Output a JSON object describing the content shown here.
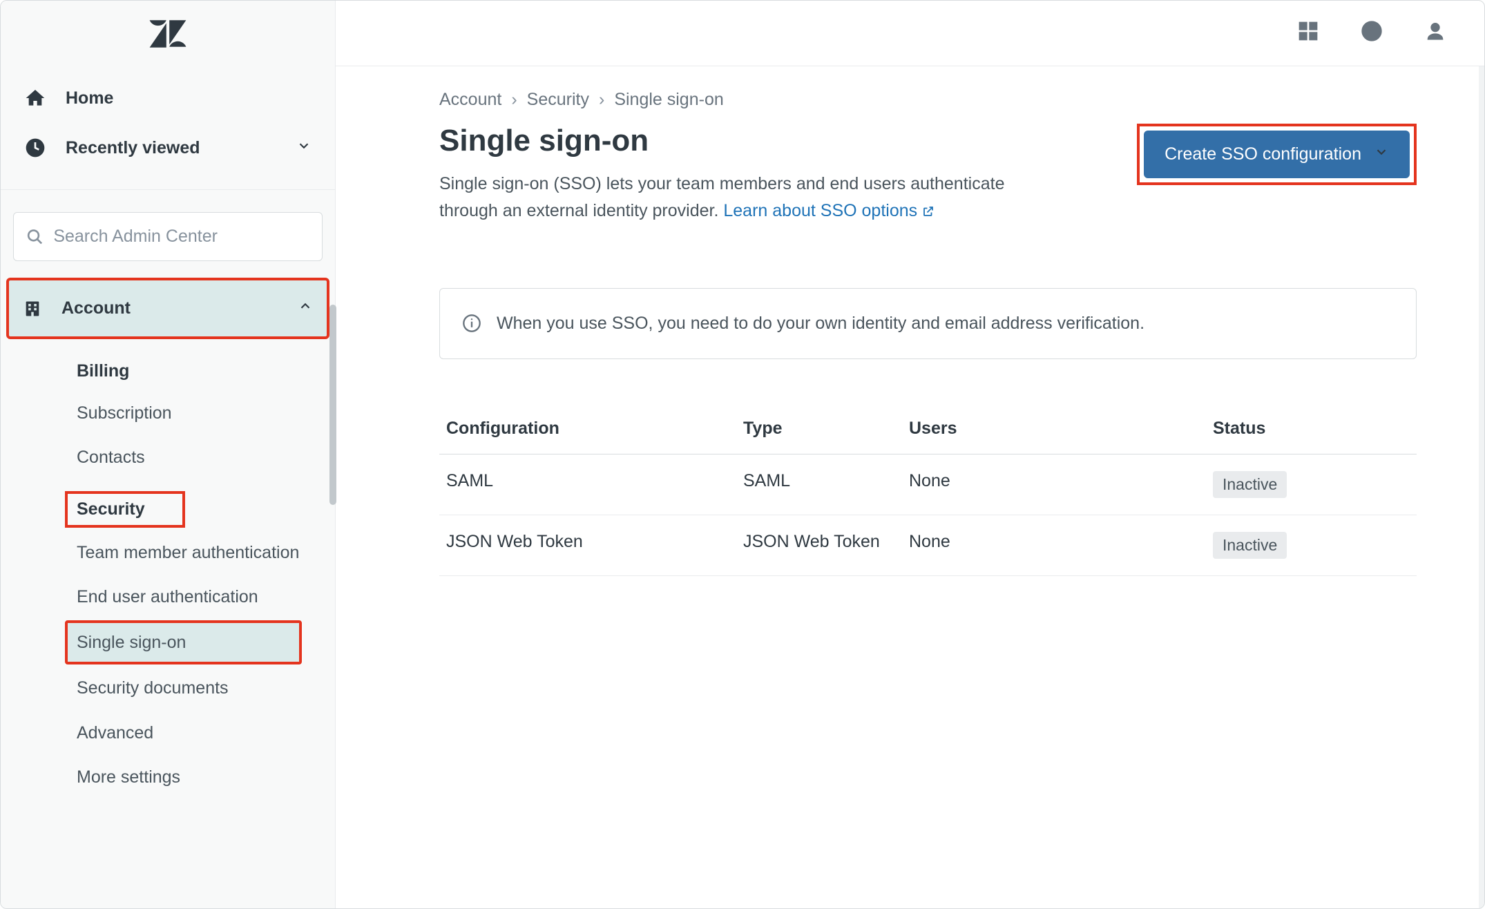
{
  "sidebar": {
    "home": "Home",
    "recent": "Recently viewed",
    "search_placeholder": "Search Admin Center",
    "section": "Account",
    "account": {
      "items": [
        "Billing",
        "Subscription",
        "Contacts"
      ]
    },
    "security": {
      "heading": "Security",
      "items": [
        "Team member authentication",
        "End user authentication",
        "Single sign-on",
        "Security documents",
        "Advanced",
        "More settings"
      ]
    }
  },
  "breadcrumb": [
    "Account",
    "Security",
    "Single sign-on"
  ],
  "page": {
    "title": "Single sign-on",
    "desc_prefix": "Single sign-on (SSO) lets your team members and end users authenticate through an external identity provider. ",
    "desc_link": "Learn about SSO options"
  },
  "cta": "Create SSO configuration",
  "notice": "When you use SSO, you need to do your own identity and email address verification.",
  "table": {
    "headers": [
      "Configuration",
      "Type",
      "Users",
      "Status"
    ],
    "rows": [
      {
        "config": "SAML",
        "type": "SAML",
        "users": "None",
        "status": "Inactive"
      },
      {
        "config": "JSON Web Token",
        "type": "JSON Web Token",
        "users": "None",
        "status": "Inactive"
      }
    ]
  }
}
